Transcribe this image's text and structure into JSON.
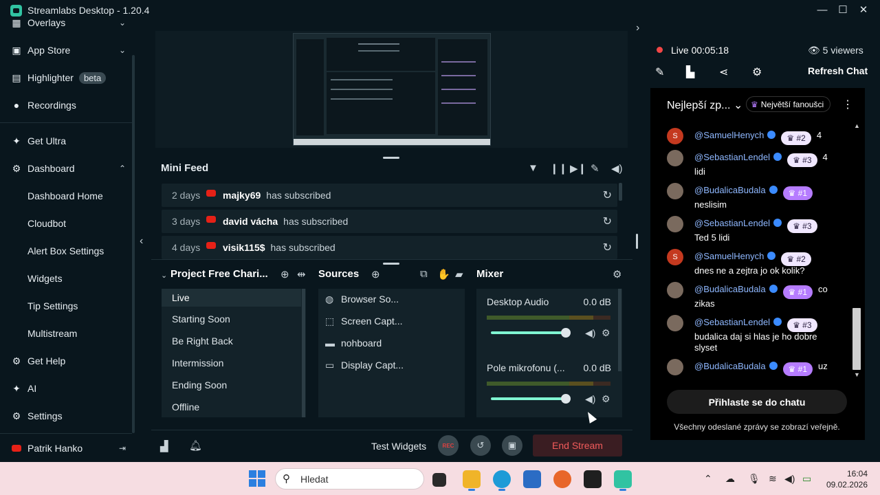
{
  "window": {
    "title": "Streamlabs Desktop - 1.20.4",
    "minimize": "—",
    "maximize": "☐",
    "close": "✕"
  },
  "sidebar": {
    "items": [
      {
        "label": "Overlays"
      },
      {
        "label": "App Store"
      },
      {
        "label": "Highlighter",
        "badge": "beta"
      },
      {
        "label": "Recordings"
      },
      {
        "label": "Get Ultra"
      },
      {
        "label": "Dashboard"
      },
      {
        "label": "Dashboard Home"
      },
      {
        "label": "Cloudbot"
      },
      {
        "label": "Alert Box Settings"
      },
      {
        "label": "Widgets"
      },
      {
        "label": "Tip Settings"
      },
      {
        "label": "Multistream"
      },
      {
        "label": "Get Help"
      },
      {
        "label": "AI"
      },
      {
        "label": "Settings"
      }
    ],
    "user": "Patrik Hanko"
  },
  "minifeed": {
    "title": "Mini Feed",
    "rows": [
      {
        "time": "2 days",
        "user": "majky69",
        "action": "has subscribed"
      },
      {
        "time": "3 days",
        "user": "david vácha",
        "action": "has subscribed"
      },
      {
        "time": "4 days",
        "user": "visik115$",
        "action": "has subscribed"
      }
    ]
  },
  "scenes": {
    "title": "Project Free Chari...",
    "items": [
      "Live",
      "Starting Soon",
      "Be Right Back",
      "Intermission",
      "Ending Soon",
      "Offline"
    ],
    "active": "Live"
  },
  "sources": {
    "title": "Sources",
    "items": [
      {
        "label": "Browser So...",
        "icon": "globe-icon"
      },
      {
        "label": "Screen Capt...",
        "icon": "screen-capture-icon"
      },
      {
        "label": "nohboard",
        "icon": "window-icon"
      },
      {
        "label": "Display Capt...",
        "icon": "monitor-icon"
      }
    ]
  },
  "mixer": {
    "title": "Mixer",
    "channels": [
      {
        "name": "Desktop Audio",
        "db": "0.0 dB",
        "volume": 0.95
      },
      {
        "name": "Pole mikrofonu (...",
        "db": "0.0 dB",
        "volume": 0.95
      }
    ]
  },
  "bottombar": {
    "test_widgets": "Test Widgets",
    "rec": "REC",
    "end_stream": "End Stream"
  },
  "chat": {
    "live_label": "Live",
    "live_time": "00:05:18",
    "viewers": "5 viewers",
    "refresh": "Refresh Chat",
    "sort_label": "Nejlepší zp...",
    "fans_label": "Největší fanoušci",
    "messages": [
      {
        "user": "@SamuelHenych",
        "rank": "#2",
        "text": "4",
        "avatar": "S"
      },
      {
        "user": "@SebastianLendel",
        "rank": "#3",
        "text": "4",
        "text2": "lidi",
        "avatar": ""
      },
      {
        "user": "@BudalicaBudala",
        "rank": "#1",
        "text": "",
        "text2": "neslisim",
        "avatar": ""
      },
      {
        "user": "@SebastianLendel",
        "rank": "#3",
        "text": "",
        "text2": "Ted 5 lidi",
        "avatar": ""
      },
      {
        "user": "@SamuelHenych",
        "rank": "#2",
        "text": "",
        "text2": "dnes ne a zejtra jo ok kolik?",
        "avatar": "S"
      },
      {
        "user": "@BudalicaBudala",
        "rank": "#1",
        "text": "co",
        "text2": "zikas",
        "avatar": ""
      },
      {
        "user": "@SebastianLendel",
        "rank": "#3",
        "text": "",
        "text2": "budalica daj si hlas je ho dobre slyset",
        "avatar": ""
      },
      {
        "user": "@BudalicaBudala",
        "rank": "#1",
        "text": "uz",
        "avatar": ""
      }
    ],
    "login": "Přihlaste se do chatu",
    "note": "Všechny odeslané zprávy se zobrazí veřejně."
  },
  "taskbar": {
    "search_placeholder": "Hledat",
    "time": "16:04",
    "date": "09.02.2026"
  }
}
